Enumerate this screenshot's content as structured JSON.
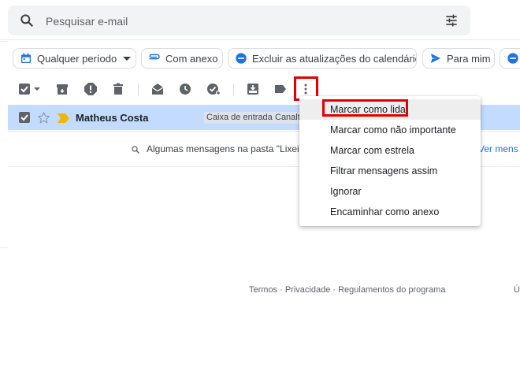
{
  "search": {
    "placeholder": "Pesquisar e-mail"
  },
  "chips": [
    {
      "label": "Qualquer período",
      "icon": "calendar-icon"
    },
    {
      "label": "Com anexo",
      "icon": "paperclip-icon"
    },
    {
      "label": "Excluir as atualizações do calendário",
      "icon": "minus-circle-icon"
    },
    {
      "label": "Para mim",
      "icon": "send-icon"
    }
  ],
  "toolbar": {
    "icons": [
      "select-all-checkbox",
      "archive-icon",
      "report-spam-icon",
      "delete-icon",
      "mark-read-icon",
      "snooze-icon",
      "add-task-icon",
      "move-to-icon",
      "label-icon",
      "more-vert-icon"
    ]
  },
  "email": {
    "sender": "Matheus Costa",
    "labels": [
      "Caixa de entrada",
      "Canalte"
    ]
  },
  "notice": {
    "text": "Algumas mensagens na pasta \"Lixeira",
    "link": "Ver mens"
  },
  "footer": {
    "text": "Termos · Privacidade · Regulamentos do programa",
    "right": "Ú"
  },
  "menu": {
    "items": [
      "Marcar como lida",
      "Marcar como não importante",
      "Marcar com estrela",
      "Filtrar mensagens assim",
      "Ignorar",
      "Encaminhar como anexo"
    ]
  },
  "colors": {
    "accent": "#1a73e8",
    "selected_row": "#c2dbff",
    "highlight": "#e00000",
    "important": "#f2b600"
  }
}
